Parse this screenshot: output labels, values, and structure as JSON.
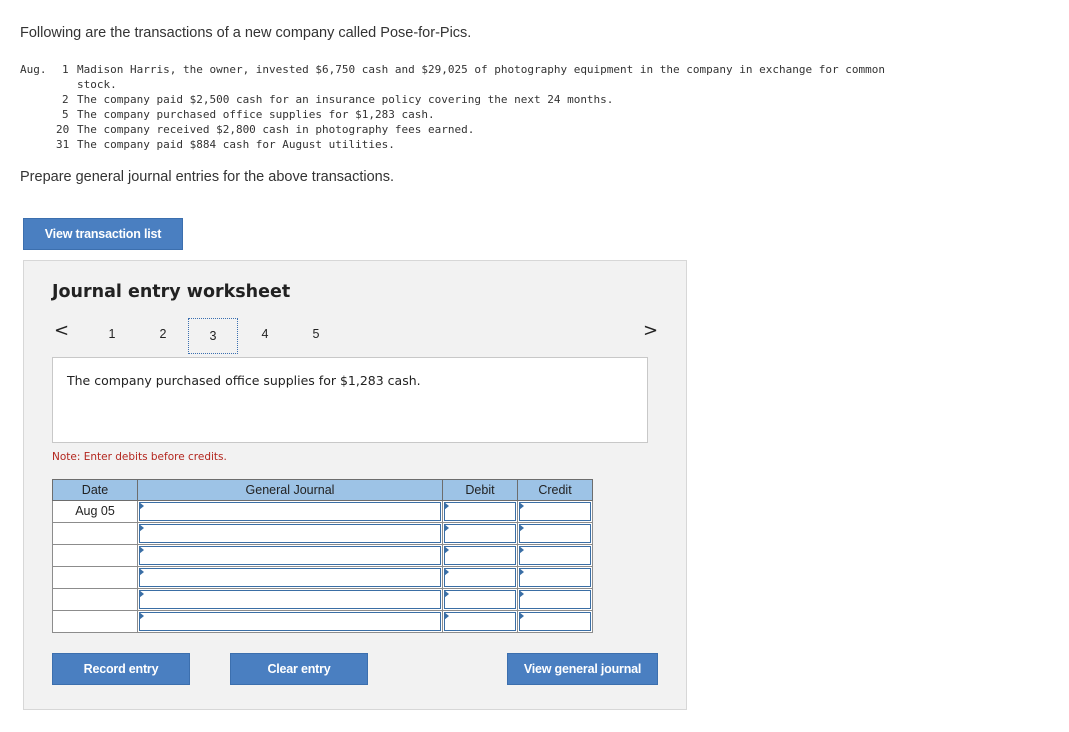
{
  "intro": "Following are the transactions of a new company called Pose-for-Pics.",
  "transactions": [
    {
      "month": "Aug.",
      "day": "1",
      "text": "Madison Harris, the owner, invested $6,750 cash and $29,025 of photography equipment in the company in exchange for common"
    },
    {
      "month": "",
      "day": "",
      "text": "stock."
    },
    {
      "month": "",
      "day": "2",
      "text": "The company paid $2,500 cash for an insurance policy covering the next 24 months."
    },
    {
      "month": "",
      "day": "5",
      "text": "The company purchased office supplies for $1,283 cash."
    },
    {
      "month": "",
      "day": "20",
      "text": "The company received $2,800 cash in photography fees earned."
    },
    {
      "month": "",
      "day": "31",
      "text": "The company paid $884 cash for August utilities."
    }
  ],
  "prompt": "Prepare general journal entries for the above transactions.",
  "buttons": {
    "view_transactions": "View transaction list",
    "record": "Record entry",
    "clear": "Clear entry",
    "view_journal": "View general journal"
  },
  "worksheet": {
    "title": "Journal entry worksheet",
    "prev_arrow": "<",
    "next_arrow": ">",
    "tabs": [
      "1",
      "2",
      "3",
      "4",
      "5"
    ],
    "active_tab": "3",
    "description": "The company purchased office supplies for $1,283 cash.",
    "note": "Note: Enter debits before credits."
  },
  "journal": {
    "headers": {
      "date": "Date",
      "account": "General Journal",
      "debit": "Debit",
      "credit": "Credit"
    },
    "rows": [
      {
        "date": "Aug 05"
      },
      {
        "date": ""
      },
      {
        "date": ""
      },
      {
        "date": ""
      },
      {
        "date": ""
      },
      {
        "date": ""
      }
    ]
  },
  "colors": {
    "button": "#4a7fc1",
    "table_header": "#9dc3e6",
    "note_text": "#b3261e",
    "panel": "#f2f2f2"
  }
}
